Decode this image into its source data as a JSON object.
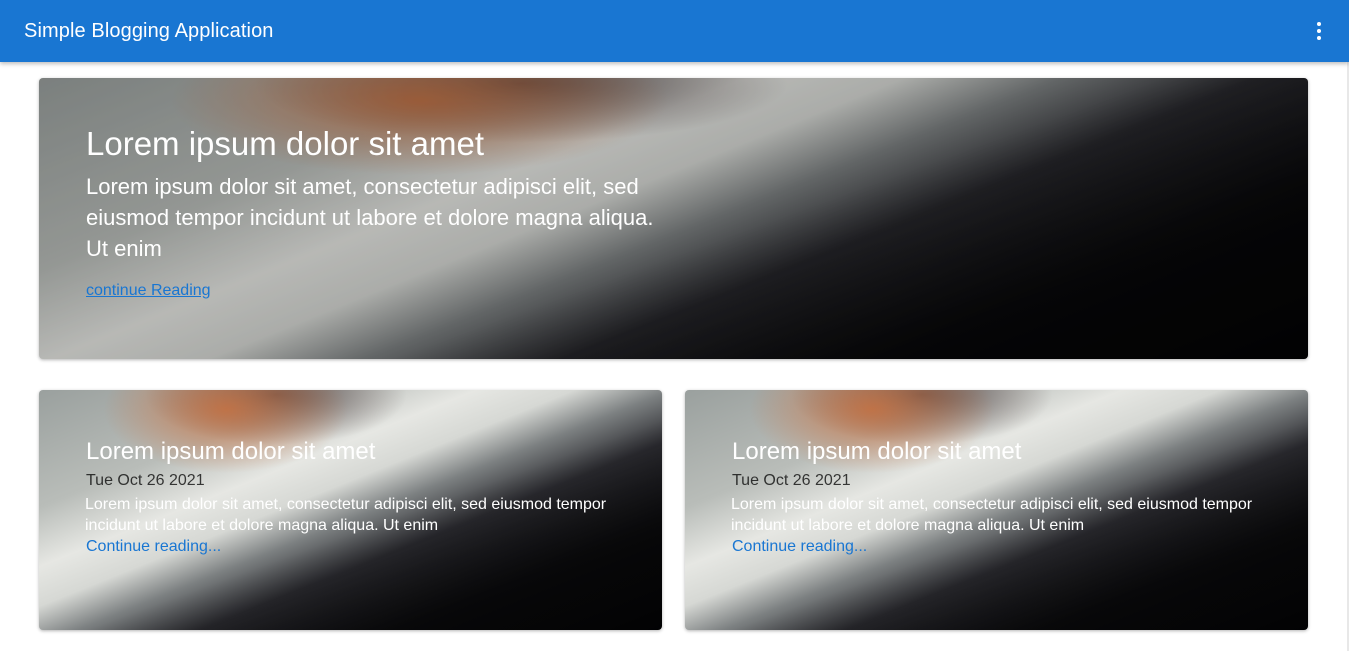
{
  "app": {
    "title": "Simple Blogging Application",
    "menu_icon": "more-vert-icon"
  },
  "colors": {
    "primary": "#1976d2",
    "link": "#1976d2",
    "text_on_image": "#ffffff"
  },
  "featured_post": {
    "title": "Lorem ipsum dolor sit amet",
    "description": "Lorem ipsum dolor sit amet, consectetur adipisci elit, sed eiusmod tempor incidunt ut labore et dolore magna aliqua. Ut enim",
    "link_text": "continue Reading"
  },
  "posts": [
    {
      "title": "Lorem ipsum dolor sit amet",
      "date": "Tue Oct 26 2021",
      "description": "Lorem ipsum dolor sit amet, consectetur adipisci elit, sed eiusmod tempor incidunt ut labore et dolore magna aliqua. Ut enim",
      "link_text": "Continue reading..."
    },
    {
      "title": "Lorem ipsum dolor sit amet",
      "date": "Tue Oct 26 2021",
      "description": "Lorem ipsum dolor sit amet, consectetur adipisci elit, sed eiusmod tempor incidunt ut labore et dolore magna aliqua. Ut enim",
      "link_text": "Continue reading..."
    }
  ]
}
